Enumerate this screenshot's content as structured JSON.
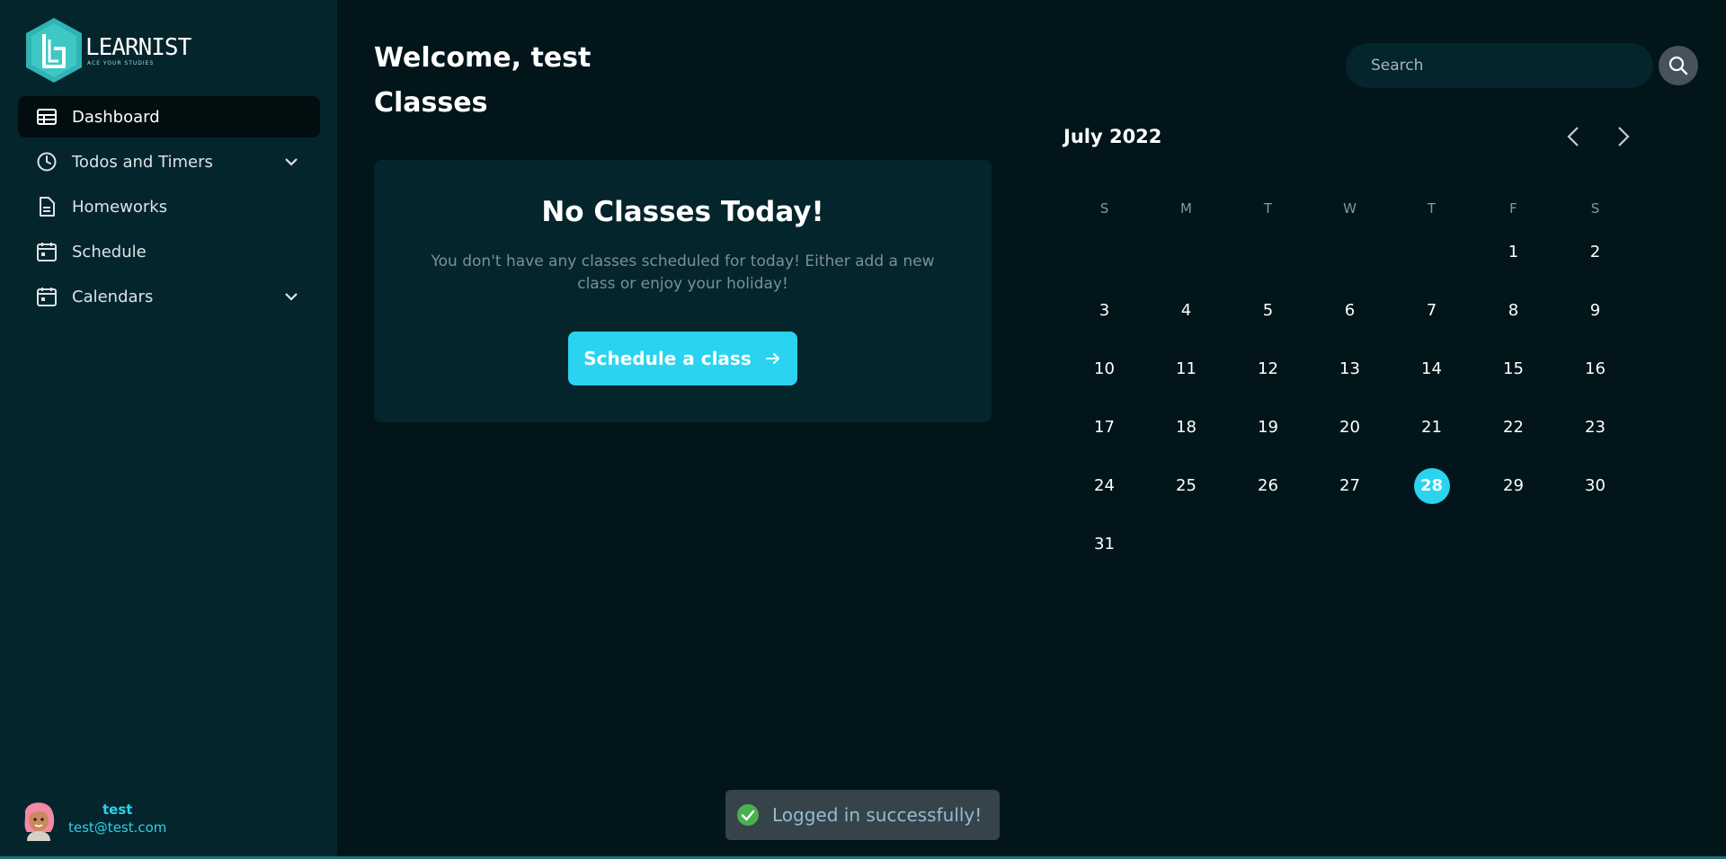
{
  "brand": {
    "name": "LEARNIST",
    "tagline": "ACE YOUR STUDIES",
    "color": "#2ad3ef"
  },
  "sidebar": {
    "items": [
      {
        "label": "Dashboard",
        "icon": "table-icon",
        "active": true
      },
      {
        "label": "Todos and Timers",
        "icon": "clock-icon",
        "expandable": true
      },
      {
        "label": "Homeworks",
        "icon": "document-icon"
      },
      {
        "label": "Schedule",
        "icon": "calendar-icon"
      },
      {
        "label": "Calendars",
        "icon": "calendar-icon",
        "expandable": true
      }
    ]
  },
  "user": {
    "name": "test",
    "email": "test@test.com",
    "avatar": "avatar-icon"
  },
  "header": {
    "welcome": "Welcome, test",
    "section_title": "Classes"
  },
  "classes_card": {
    "title": "No Classes Today!",
    "description": "You don't have any classes scheduled for today! Either add a new class or enjoy your holiday!",
    "button_label": "Schedule a class"
  },
  "search": {
    "placeholder": "Search"
  },
  "calendar": {
    "title": "July 2022",
    "weekdays": [
      "S",
      "M",
      "T",
      "W",
      "T",
      "F",
      "S"
    ],
    "weeks": [
      [
        "",
        "",
        "",
        "",
        "",
        "1",
        "2"
      ],
      [
        "3",
        "4",
        "5",
        "6",
        "7",
        "8",
        "9"
      ],
      [
        "10",
        "11",
        "12",
        "13",
        "14",
        "15",
        "16"
      ],
      [
        "17",
        "18",
        "19",
        "20",
        "21",
        "22",
        "23"
      ],
      [
        "24",
        "25",
        "26",
        "27",
        "28",
        "29",
        "30"
      ],
      [
        "31",
        "",
        "",
        "",
        "",
        "",
        ""
      ]
    ],
    "today": "28"
  },
  "toast": {
    "message": "Logged in successfully!",
    "status_color": "#4caf50"
  }
}
